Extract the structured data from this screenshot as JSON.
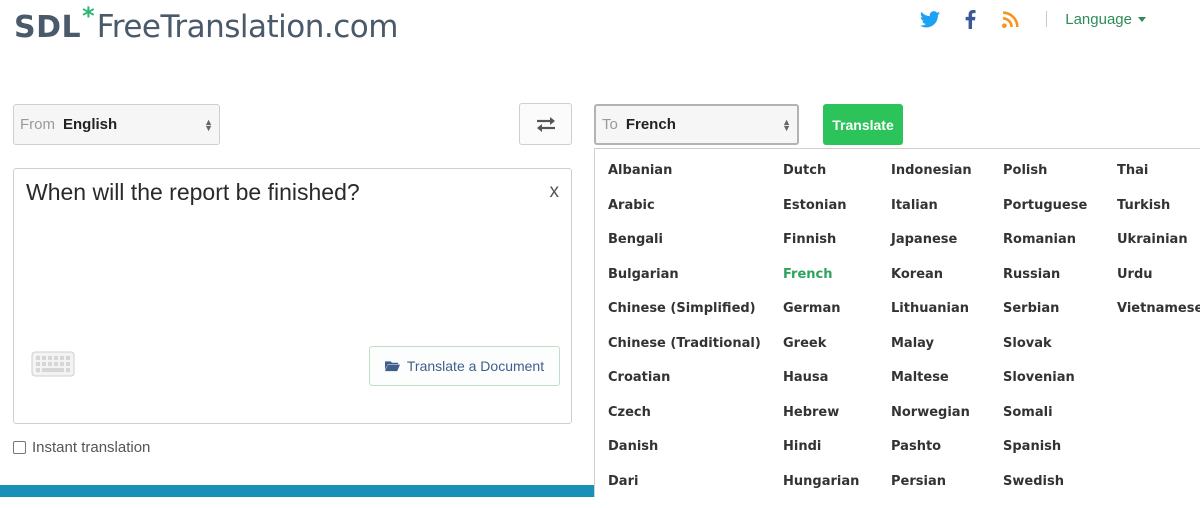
{
  "logo": {
    "sdl": "SDL",
    "star": "*",
    "site": "FreeTranslation.com"
  },
  "header": {
    "language_label": "Language"
  },
  "from": {
    "label": "From",
    "value": "English"
  },
  "to": {
    "label": "To",
    "value": "French"
  },
  "translate_button": "Translate",
  "input": {
    "text": "When will the report be finished?",
    "clear": "x"
  },
  "document_button": "Translate a Document",
  "instant": {
    "label": "Instant translation",
    "checked": false
  },
  "colors": {
    "accent_green": "#2cc45a",
    "link_green": "#2e8b57",
    "bar_blue": "#1991b6",
    "twitter": "#1da1f2",
    "facebook": "#3b5998",
    "rss": "#f7931e"
  },
  "languages": [
    [
      "Albanian",
      "Arabic",
      "Bengali",
      "Bulgarian",
      "Chinese (Simplified)",
      "Chinese (Traditional)",
      "Croatian",
      "Czech",
      "Danish",
      "Dari"
    ],
    [
      "Dutch",
      "Estonian",
      "Finnish",
      "French",
      "German",
      "Greek",
      "Hausa",
      "Hebrew",
      "Hindi",
      "Hungarian"
    ],
    [
      "Indonesian",
      "Italian",
      "Japanese",
      "Korean",
      "Lithuanian",
      "Malay",
      "Maltese",
      "Norwegian",
      "Pashto",
      "Persian"
    ],
    [
      "Polish",
      "Portuguese",
      "Romanian",
      "Russian",
      "Serbian",
      "Slovak",
      "Slovenian",
      "Somali",
      "Spanish",
      "Swedish"
    ],
    [
      "Thai",
      "Turkish",
      "Ukrainian",
      "Urdu",
      "Vietnamese"
    ]
  ],
  "selected_language": "French",
  "icons": [
    "twitter-icon",
    "facebook-icon",
    "rss-icon",
    "swap-icon",
    "keyboard-icon",
    "folder-icon"
  ]
}
